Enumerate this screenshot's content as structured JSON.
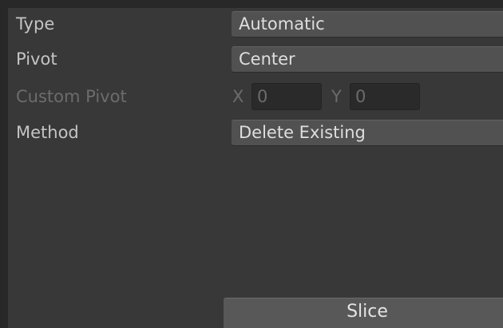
{
  "fields": {
    "type": {
      "label": "Type",
      "value": "Automatic"
    },
    "pivot": {
      "label": "Pivot",
      "value": "Center"
    },
    "custom_pivot": {
      "label": "Custom Pivot",
      "x_label": "X",
      "x_value": "0",
      "y_label": "Y",
      "y_value": "0"
    },
    "method": {
      "label": "Method",
      "value": "Delete Existing"
    }
  },
  "actions": {
    "slice_label": "Slice"
  },
  "colors": {
    "background": "#383838",
    "border": "#282828",
    "dropdown": "#515151",
    "field": "#2a2a2a",
    "text": "#c4c4c4",
    "text_disabled": "#6c6c6c"
  }
}
